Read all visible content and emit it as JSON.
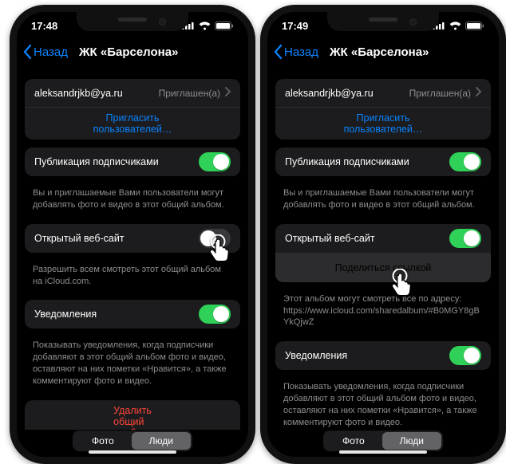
{
  "left": {
    "statusbar": {
      "time": "17:48"
    },
    "nav": {
      "back": "Назад",
      "title": "ЖК «Барселона»"
    },
    "invitee": {
      "email": "aleksandrjkb@ya.ru",
      "status": "Приглашен(а)"
    },
    "invite_link": "Пригласить пользователей…",
    "subscriber_posting": {
      "label": "Публикация подписчиками",
      "on": true,
      "footer": "Вы и приглашаемые Вами пользователи могут добавлять фото и видео в этот общий альбом."
    },
    "public_site": {
      "label": "Открытый веб-сайт",
      "on": false,
      "footer": "Разрешить всем смотреть этот общий альбом на iCloud.com."
    },
    "notifications": {
      "label": "Уведомления",
      "on": true,
      "footer": "Показывать уведомления, когда подписчики добавляют в этот общий альбом фото и видео, оставляют на них пометки «Нравится», а также комментируют фото и видео."
    },
    "delete": "Удалить общий альбом",
    "segment": {
      "a": "Фото",
      "b": "Люди",
      "selected": "b"
    }
  },
  "right": {
    "statusbar": {
      "time": "17:49"
    },
    "nav": {
      "back": "Назад",
      "title": "ЖК «Барселона»"
    },
    "invitee": {
      "email": "aleksandrjkb@ya.ru",
      "status": "Приглашен(а)"
    },
    "invite_link": "Пригласить пользователей…",
    "subscriber_posting": {
      "label": "Публикация подписчиками",
      "on": true,
      "footer": "Вы и приглашаемые Вами пользователи могут добавлять фото и видео в этот общий альбом."
    },
    "public_site": {
      "label": "Открытый веб-сайт",
      "on": true,
      "share_button": "Поделиться ссылкой",
      "footer_prefix": "Этот альбом могут смотреть все по адресу:",
      "footer_link": "https://www.icloud.com/sharedalbum/#B0MGY8gBYkQjwZ"
    },
    "notifications": {
      "label": "Уведомления",
      "on": true,
      "footer": "Показывать уведомления, когда подписчики добавляют в этот общий альбом фото и видео, оставляют на них пометки «Нравится», а также комментируют фото и видео."
    },
    "segment": {
      "a": "Фото",
      "b": "Люди",
      "selected": "b"
    }
  }
}
